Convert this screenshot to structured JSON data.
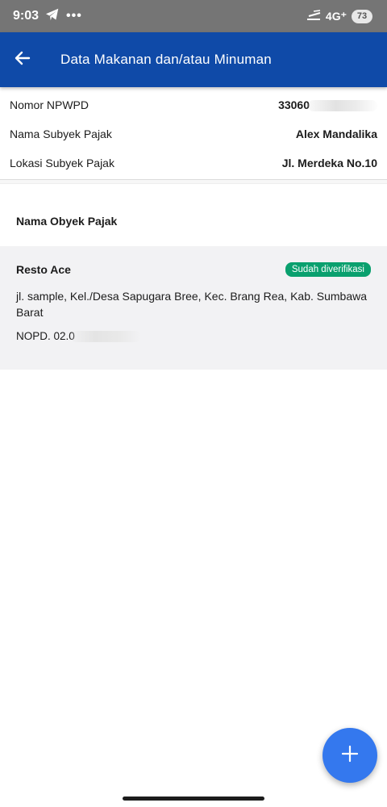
{
  "status_bar": {
    "time": "9:03",
    "overflow": "•••",
    "network": "4G⁺",
    "battery": "73"
  },
  "app_bar": {
    "title": "Data Makanan dan/atau Minuman"
  },
  "taxpayer": {
    "rows": [
      {
        "label": "Nomor NPWPD",
        "value": "33060"
      },
      {
        "label": "Nama Subyek Pajak",
        "value": "Alex Mandalika"
      },
      {
        "label": "Lokasi Subyek Pajak",
        "value": "Jl. Merdeka No.10"
      }
    ]
  },
  "section": {
    "title": "Nama Obyek Pajak"
  },
  "objects": [
    {
      "name": "Resto Ace",
      "status": "Sudah diverifikasi",
      "address": "jl. sample, Kel./Desa Sapugara Bree, Kec. Brang Rea, Kab. Sumbawa Barat",
      "nopd": "NOPD. 02.0"
    }
  ],
  "colors": {
    "app_bar": "#0f4aa8",
    "status_badge": "#0aa06e",
    "fab": "#3478ee"
  },
  "icons": {
    "back": "arrow-left-icon",
    "add": "plus-icon"
  }
}
